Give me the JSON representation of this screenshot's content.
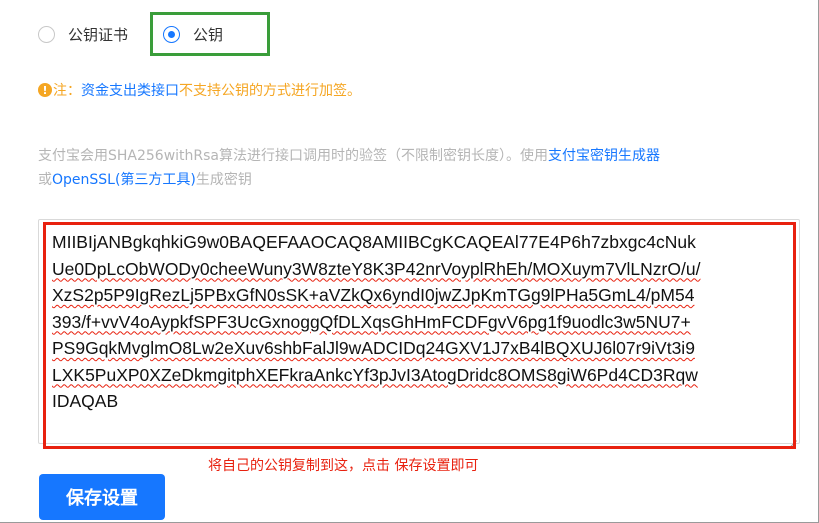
{
  "key_type": {
    "options": [
      {
        "label": "公钥证书",
        "checked": false
      },
      {
        "label": "公钥",
        "checked": true
      }
    ]
  },
  "note": {
    "prefix": "注：",
    "link": "资金支出类接口",
    "text": "不支持公钥的方式进行加签。"
  },
  "description": {
    "text_1": "支付宝会用SHA256withRsa算法进行接口调用时的验签（不限制密钥长度）。使用",
    "link_1": "支付宝密钥生成器",
    "text_2": "或",
    "link_2": "OpenSSL(第三方工具)",
    "text_3": "生成密钥"
  },
  "public_key": {
    "lines": [
      "MIIBIjANBgkqhkiG9w0BAQEFAAOCAQ8AMIIBCgKCAQEAl77E4P6h7zbxgc4cNuk",
      "Ue0DpLcObWODy0cheeWuny3W8zteY8K3P42nrVoyplRhEh/MOXuym7VlLNzrO/u/",
      "XzS2p5P9IgRezLj5PBxGfN0sSK+aVZkQx6yndI0jwZJpKmTGg9lPHa5GmL4/pM54",
      "393/f+vvV4oAypkfSPF3UcGxnoggQfDLXqsGhHmFCDFgvV6pg1f9uodlc3w5NU7+",
      "PS9GqkMvglmO8Lw2eXuv6shbFalJl9wADCIDq24GXV1J7xB4lBQXUJ6l07r9iVt3i9",
      "LXK5PuXP0XZeDkmgitphXEFkraAnkcYf3pJvI3AtogDridc8OMS8giW6Pd4CD3Rqw",
      "IDAQAB"
    ]
  },
  "hint": "将自己的公钥复制到这，点击 保存设置即可",
  "save_button": "保存设置",
  "colors": {
    "primary": "#1677ff",
    "warning": "#f5a623",
    "annotation_red": "#e8210f",
    "annotation_green": "#3a9d3a"
  }
}
